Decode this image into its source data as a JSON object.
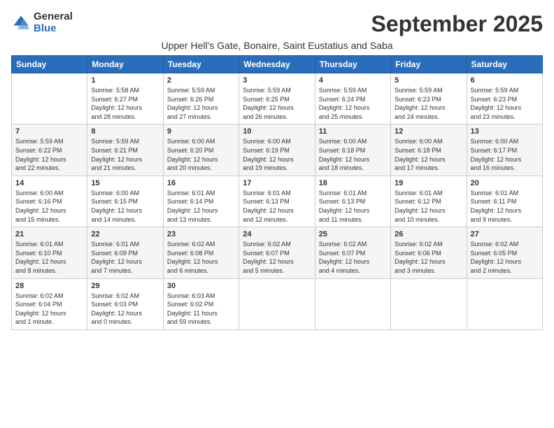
{
  "logo": {
    "general": "General",
    "blue": "Blue"
  },
  "title": "September 2025",
  "subtitle": "Upper Hell's Gate, Bonaire, Saint Eustatius and Saba",
  "weekdays": [
    "Sunday",
    "Monday",
    "Tuesday",
    "Wednesday",
    "Thursday",
    "Friday",
    "Saturday"
  ],
  "weeks": [
    [
      {
        "day": "",
        "info": ""
      },
      {
        "day": "1",
        "info": "Sunrise: 5:58 AM\nSunset: 6:27 PM\nDaylight: 12 hours\nand 28 minutes."
      },
      {
        "day": "2",
        "info": "Sunrise: 5:59 AM\nSunset: 6:26 PM\nDaylight: 12 hours\nand 27 minutes."
      },
      {
        "day": "3",
        "info": "Sunrise: 5:59 AM\nSunset: 6:25 PM\nDaylight: 12 hours\nand 26 minutes."
      },
      {
        "day": "4",
        "info": "Sunrise: 5:59 AM\nSunset: 6:24 PM\nDaylight: 12 hours\nand 25 minutes."
      },
      {
        "day": "5",
        "info": "Sunrise: 5:59 AM\nSunset: 6:23 PM\nDaylight: 12 hours\nand 24 minutes."
      },
      {
        "day": "6",
        "info": "Sunrise: 5:59 AM\nSunset: 6:23 PM\nDaylight: 12 hours\nand 23 minutes."
      }
    ],
    [
      {
        "day": "7",
        "info": "Sunrise: 5:59 AM\nSunset: 6:22 PM\nDaylight: 12 hours\nand 22 minutes."
      },
      {
        "day": "8",
        "info": "Sunrise: 5:59 AM\nSunset: 6:21 PM\nDaylight: 12 hours\nand 21 minutes."
      },
      {
        "day": "9",
        "info": "Sunrise: 6:00 AM\nSunset: 6:20 PM\nDaylight: 12 hours\nand 20 minutes."
      },
      {
        "day": "10",
        "info": "Sunrise: 6:00 AM\nSunset: 6:19 PM\nDaylight: 12 hours\nand 19 minutes."
      },
      {
        "day": "11",
        "info": "Sunrise: 6:00 AM\nSunset: 6:18 PM\nDaylight: 12 hours\nand 18 minutes."
      },
      {
        "day": "12",
        "info": "Sunrise: 6:00 AM\nSunset: 6:18 PM\nDaylight: 12 hours\nand 17 minutes."
      },
      {
        "day": "13",
        "info": "Sunrise: 6:00 AM\nSunset: 6:17 PM\nDaylight: 12 hours\nand 16 minutes."
      }
    ],
    [
      {
        "day": "14",
        "info": "Sunrise: 6:00 AM\nSunset: 6:16 PM\nDaylight: 12 hours\nand 15 minutes."
      },
      {
        "day": "15",
        "info": "Sunrise: 6:00 AM\nSunset: 6:15 PM\nDaylight: 12 hours\nand 14 minutes."
      },
      {
        "day": "16",
        "info": "Sunrise: 6:01 AM\nSunset: 6:14 PM\nDaylight: 12 hours\nand 13 minutes."
      },
      {
        "day": "17",
        "info": "Sunrise: 6:01 AM\nSunset: 6:13 PM\nDaylight: 12 hours\nand 12 minutes."
      },
      {
        "day": "18",
        "info": "Sunrise: 6:01 AM\nSunset: 6:13 PM\nDaylight: 12 hours\nand 11 minutes."
      },
      {
        "day": "19",
        "info": "Sunrise: 6:01 AM\nSunset: 6:12 PM\nDaylight: 12 hours\nand 10 minutes."
      },
      {
        "day": "20",
        "info": "Sunrise: 6:01 AM\nSunset: 6:11 PM\nDaylight: 12 hours\nand 9 minutes."
      }
    ],
    [
      {
        "day": "21",
        "info": "Sunrise: 6:01 AM\nSunset: 6:10 PM\nDaylight: 12 hours\nand 8 minutes."
      },
      {
        "day": "22",
        "info": "Sunrise: 6:01 AM\nSunset: 6:09 PM\nDaylight: 12 hours\nand 7 minutes."
      },
      {
        "day": "23",
        "info": "Sunrise: 6:02 AM\nSunset: 6:08 PM\nDaylight: 12 hours\nand 6 minutes."
      },
      {
        "day": "24",
        "info": "Sunrise: 6:02 AM\nSunset: 6:07 PM\nDaylight: 12 hours\nand 5 minutes."
      },
      {
        "day": "25",
        "info": "Sunrise: 6:02 AM\nSunset: 6:07 PM\nDaylight: 12 hours\nand 4 minutes."
      },
      {
        "day": "26",
        "info": "Sunrise: 6:02 AM\nSunset: 6:06 PM\nDaylight: 12 hours\nand 3 minutes."
      },
      {
        "day": "27",
        "info": "Sunrise: 6:02 AM\nSunset: 6:05 PM\nDaylight: 12 hours\nand 2 minutes."
      }
    ],
    [
      {
        "day": "28",
        "info": "Sunrise: 6:02 AM\nSunset: 6:04 PM\nDaylight: 12 hours\nand 1 minute."
      },
      {
        "day": "29",
        "info": "Sunrise: 6:02 AM\nSunset: 6:03 PM\nDaylight: 12 hours\nand 0 minutes."
      },
      {
        "day": "30",
        "info": "Sunrise: 6:03 AM\nSunset: 6:02 PM\nDaylight: 11 hours\nand 59 minutes."
      },
      {
        "day": "",
        "info": ""
      },
      {
        "day": "",
        "info": ""
      },
      {
        "day": "",
        "info": ""
      },
      {
        "day": "",
        "info": ""
      }
    ]
  ]
}
